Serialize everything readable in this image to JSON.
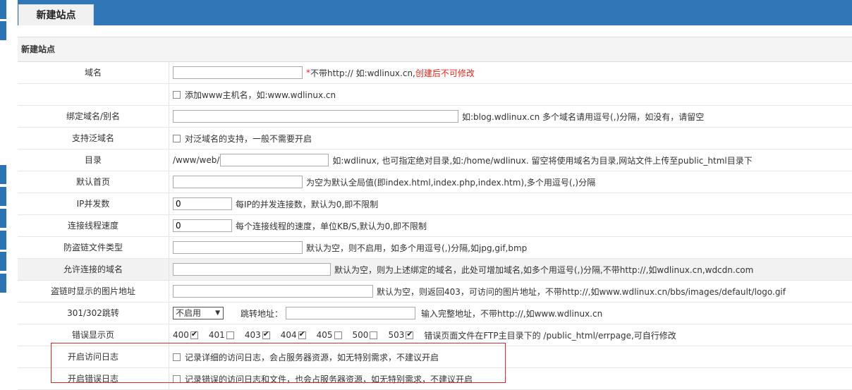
{
  "header": {
    "tab_title": "新建站点"
  },
  "section_title": "新建站点",
  "rows": {
    "domain": {
      "label": "域名",
      "hint_star": "*",
      "hint": "不带http:// 如:wdlinux.cn,",
      "hint_red": "创建后不可修改"
    },
    "www": {
      "label": "",
      "text": "添加www主机名，如:www.wdlinux.cn"
    },
    "bind": {
      "label": "绑定域名/别名",
      "hint": "如:blog.wdlinux.cn 多个域名请用逗号(,)分隔，如没有，请留空"
    },
    "wildcard": {
      "label": "支持泛域名",
      "text": "对泛域名的支持，一般不需要开启"
    },
    "dir": {
      "label": "目录",
      "prefix": "/www/web/",
      "hint": "如:wdlinux, 也可指定绝对目录,如:/home/wdlinux. 留空将使用域名为目录,网站文件上传至public_html目录下"
    },
    "index": {
      "label": "默认首页",
      "hint": "为空为默认全局值(即index.html,index.php,index.htm),多个用逗号(,)分隔"
    },
    "ipconn": {
      "label": "IP并发数",
      "value": "0",
      "hint": "每IP的并发连接数，默认为0,即不限制"
    },
    "speed": {
      "label": "连接线程速度",
      "value": "0",
      "hint": "每个连接线程的速度，单位KB/S,默认为0,即不限制"
    },
    "hotlink_types": {
      "label": "防盗链文件类型",
      "hint": "默认为空，则不启用，如多个用逗号(,)分隔,如jpg,gif,bmp"
    },
    "allowed_domains": {
      "label": "允许连接的域名",
      "hint": "默认为空，则为上述绑定的域名，此处可增加域名,如多个用逗号(,)分隔,不带http://,如wdlinux.cn,wdcdn.com"
    },
    "hotlink_image": {
      "label": "盗链时显示的图片地址",
      "hint": "默认为空，则返回403，可访问的图片地址，不带http://,如www.wdlinux.cn/bbs/images/default/logo.gif"
    },
    "redirect": {
      "label": "301/302跳转",
      "select_value": "不启用",
      "url_label": "跳转地址：",
      "hint": "输入完整地址，不带http://,如www.wdlinux.cn"
    },
    "errors": {
      "label": "错误显示页",
      "codes": [
        {
          "code": "400",
          "checked": true
        },
        {
          "code": "401",
          "checked": false
        },
        {
          "code": "403",
          "checked": true
        },
        {
          "code": "404",
          "checked": true
        },
        {
          "code": "405",
          "checked": false
        },
        {
          "code": "500",
          "checked": false
        },
        {
          "code": "503",
          "checked": true
        }
      ],
      "hint": "错误页面文件在FTP主目录下的 /public_html/errpage,可自行修改"
    },
    "access_log": {
      "label": "开启访问日志",
      "text": "记录详细的访问日志，会占服务器资源，如无特别需求，不建议开启"
    },
    "error_log": {
      "label": "开启错误日志",
      "text": "记录错误的访问日志和文件，也会占服务器资源，如无特别需求，不建议开启"
    }
  },
  "colors": {
    "header_blue": "#2f77b7",
    "highlight_red": "#d52b2b",
    "hint_red": "#e3261a"
  }
}
